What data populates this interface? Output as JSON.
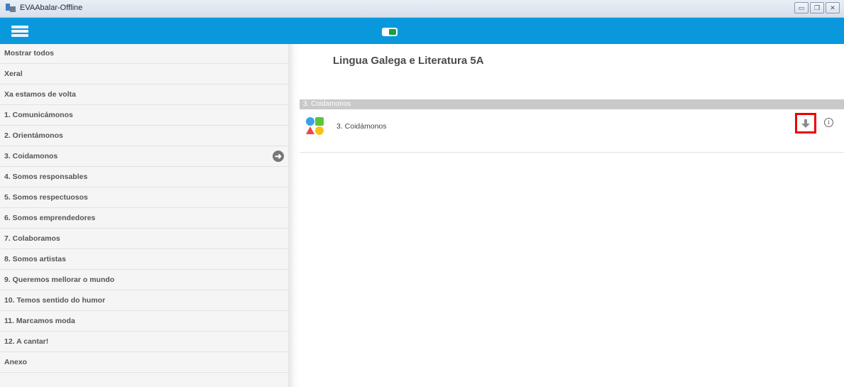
{
  "window": {
    "title": "EVAAbalar-Offline"
  },
  "header": {
    "page_title": "Lingua Galega e Literatura 5A"
  },
  "sidebar": {
    "items": [
      {
        "label": "Mostrar todos"
      },
      {
        "label": "Xeral"
      },
      {
        "label": "Xa estamos de volta"
      },
      {
        "label": "1. Comunicámonos"
      },
      {
        "label": "2. Orientámonos"
      },
      {
        "label": "3. Coidamonos",
        "selected": true,
        "icon": "arrow-right-circle-icon"
      },
      {
        "label": "4. Somos responsables"
      },
      {
        "label": "5. Somos respectuosos"
      },
      {
        "label": "6. Somos emprendedores"
      },
      {
        "label": "7. Colaboramos"
      },
      {
        "label": "8. Somos artistas"
      },
      {
        "label": "9. Queremos mellorar o mundo"
      },
      {
        "label": "10. Temos sentido do humor"
      },
      {
        "label": "11. Marcamos moda"
      },
      {
        "label": "12. A cantar!"
      },
      {
        "label": "Anexo"
      }
    ]
  },
  "main": {
    "section_label": "3. Coidamonos",
    "resource": {
      "label": "3. Coidámonos",
      "icon": "colored-shapes-icon"
    },
    "actions": {
      "download_icon": "download-arrow-icon",
      "info_icon": "info-circle-icon"
    }
  },
  "colors": {
    "toolbar": "#0a98dc",
    "highlight": "#ee0000",
    "toggle_on": "#18a23a"
  }
}
